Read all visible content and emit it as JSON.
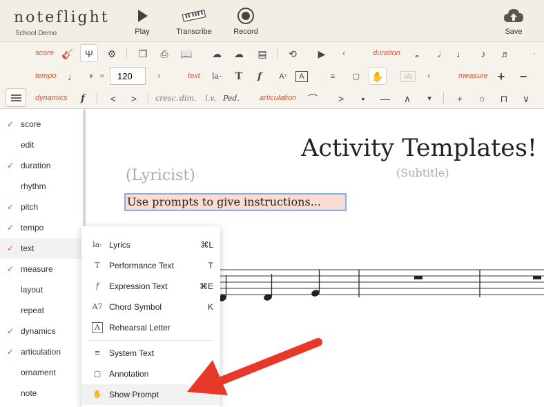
{
  "app": {
    "logo": "noteflight",
    "subtitle": "School Demo"
  },
  "toolbar": {
    "play_label": "Play",
    "transcribe_label": "Transcribe",
    "record_label": "Record",
    "save_label": "Save"
  },
  "palette": {
    "score_label": "score",
    "duration_label": "duration",
    "tempo_label": "tempo",
    "tempo_equals": "=",
    "tempo_value": "120",
    "text_label": "text",
    "measure_label": "measure",
    "dynamics_label": "dynamics",
    "articulation_label": "articulation",
    "cresc": "cresc.",
    "dim": "dim.",
    "lv": "l.v.",
    "ped": "Ped."
  },
  "sidebar": {
    "items": [
      {
        "label": "score",
        "checked": true
      },
      {
        "label": "edit",
        "checked": false
      },
      {
        "label": "duration",
        "checked": true
      },
      {
        "label": "rhythm",
        "checked": false
      },
      {
        "label": "pitch",
        "checked": true
      },
      {
        "label": "tempo",
        "checked": true
      },
      {
        "label": "text",
        "checked": true
      },
      {
        "label": "measure",
        "checked": true
      },
      {
        "label": "layout",
        "checked": false
      },
      {
        "label": "repeat",
        "checked": false
      },
      {
        "label": "dynamics",
        "checked": true
      },
      {
        "label": "articulation",
        "checked": true
      },
      {
        "label": "ornament",
        "checked": false
      },
      {
        "label": "note",
        "checked": false
      }
    ],
    "check_glyph": "✓"
  },
  "score": {
    "title": "Activity Templates!",
    "subtitle": "(Subtitle)",
    "lyricist": "(Lyricist)",
    "prompt_text": "Use prompts to give instructions..."
  },
  "context_menu": {
    "items": [
      {
        "icon": "la-",
        "label": "Lyrics",
        "shortcut": "⌘L"
      },
      {
        "icon": "T",
        "label": "Performance Text",
        "shortcut": "T"
      },
      {
        "icon": "f",
        "label": "Expression Text",
        "shortcut": "⌘E"
      },
      {
        "icon": "A7",
        "label": "Chord Symbol",
        "shortcut": "K"
      },
      {
        "icon": "A",
        "label": "Rehearsal Letter",
        "shortcut": ""
      },
      {
        "icon": "≡",
        "label": "System Text",
        "shortcut": ""
      },
      {
        "icon": "▢",
        "label": "Annotation",
        "shortcut": ""
      },
      {
        "icon": "✋",
        "label": "Show Prompt",
        "shortcut": ""
      }
    ]
  },
  "colors": {
    "accent": "#e0542c",
    "toolbar_bg": "#f2eee5",
    "prompt_bg": "#fbdcd2",
    "prompt_border": "#7fb2e6",
    "arrow": "#e8382a"
  }
}
